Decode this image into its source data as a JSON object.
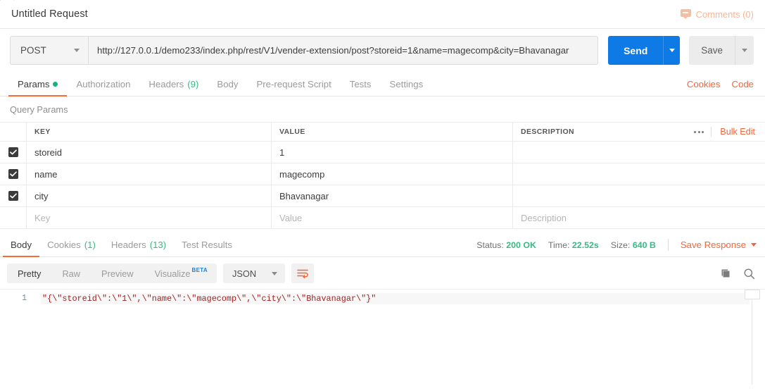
{
  "titlebar": {
    "request_title": "Untitled Request",
    "comments_label": "Comments (0)"
  },
  "request": {
    "method": "POST",
    "url": "http://127.0.0.1/demo233/index.php/rest/V1/vender-extension/post?storeid=1&name=magecomp&city=Bhavanagar",
    "send_label": "Send",
    "save_label": "Save"
  },
  "request_tabs": {
    "items": [
      {
        "label": "Params",
        "badge": "",
        "dot": true,
        "active": true
      },
      {
        "label": "Authorization",
        "badge": "",
        "dot": false,
        "active": false
      },
      {
        "label": "Headers",
        "badge": "(9)",
        "dot": false,
        "active": false
      },
      {
        "label": "Body",
        "badge": "",
        "dot": false,
        "active": false
      },
      {
        "label": "Pre-request Script",
        "badge": "",
        "dot": false,
        "active": false
      },
      {
        "label": "Tests",
        "badge": "",
        "dot": false,
        "active": false
      },
      {
        "label": "Settings",
        "badge": "",
        "dot": false,
        "active": false
      }
    ],
    "cookies_link": "Cookies",
    "code_link": "Code"
  },
  "query_params": {
    "section_label": "Query Params",
    "columns": [
      "KEY",
      "VALUE",
      "DESCRIPTION"
    ],
    "bulk_edit_label": "Bulk Edit",
    "rows": [
      {
        "checked": true,
        "key": "storeid",
        "value": "1",
        "description": ""
      },
      {
        "checked": true,
        "key": "name",
        "value": "magecomp",
        "description": ""
      },
      {
        "checked": true,
        "key": "city",
        "value": "Bhavanagar",
        "description": ""
      }
    ],
    "placeholder_row": {
      "key": "Key",
      "value": "Value",
      "description": "Description"
    }
  },
  "response_tabs": {
    "items": [
      {
        "label": "Body",
        "badge": "",
        "active": true
      },
      {
        "label": "Cookies",
        "badge": "(1)",
        "active": false
      },
      {
        "label": "Headers",
        "badge": "(13)",
        "active": false
      },
      {
        "label": "Test Results",
        "badge": "",
        "active": false
      }
    ],
    "status_label": "Status:",
    "status_value": "200 OK",
    "time_label": "Time:",
    "time_value": "22.52s",
    "size_label": "Size:",
    "size_value": "640 B",
    "save_response_label": "Save Response"
  },
  "body_toolbar": {
    "views": [
      "Pretty",
      "Raw",
      "Preview",
      "Visualize"
    ],
    "active_view": "Pretty",
    "beta_badge": "BETA",
    "format": "JSON"
  },
  "response_body": {
    "line_number": "1",
    "content": "\"{\\\"storeid\\\":\\\"1\\\",\\\"name\\\":\\\"magecomp\\\",\\\"city\\\":\\\"Bhavanagar\\\"}\""
  },
  "colors": {
    "accent_orange": "#f0663c",
    "send_blue": "#0e7ae6",
    "status_green": "#3ab884",
    "param_dot_green": "#16b37a",
    "beta_blue": "#1f7fe0",
    "string_maroon": "#9c2222"
  }
}
